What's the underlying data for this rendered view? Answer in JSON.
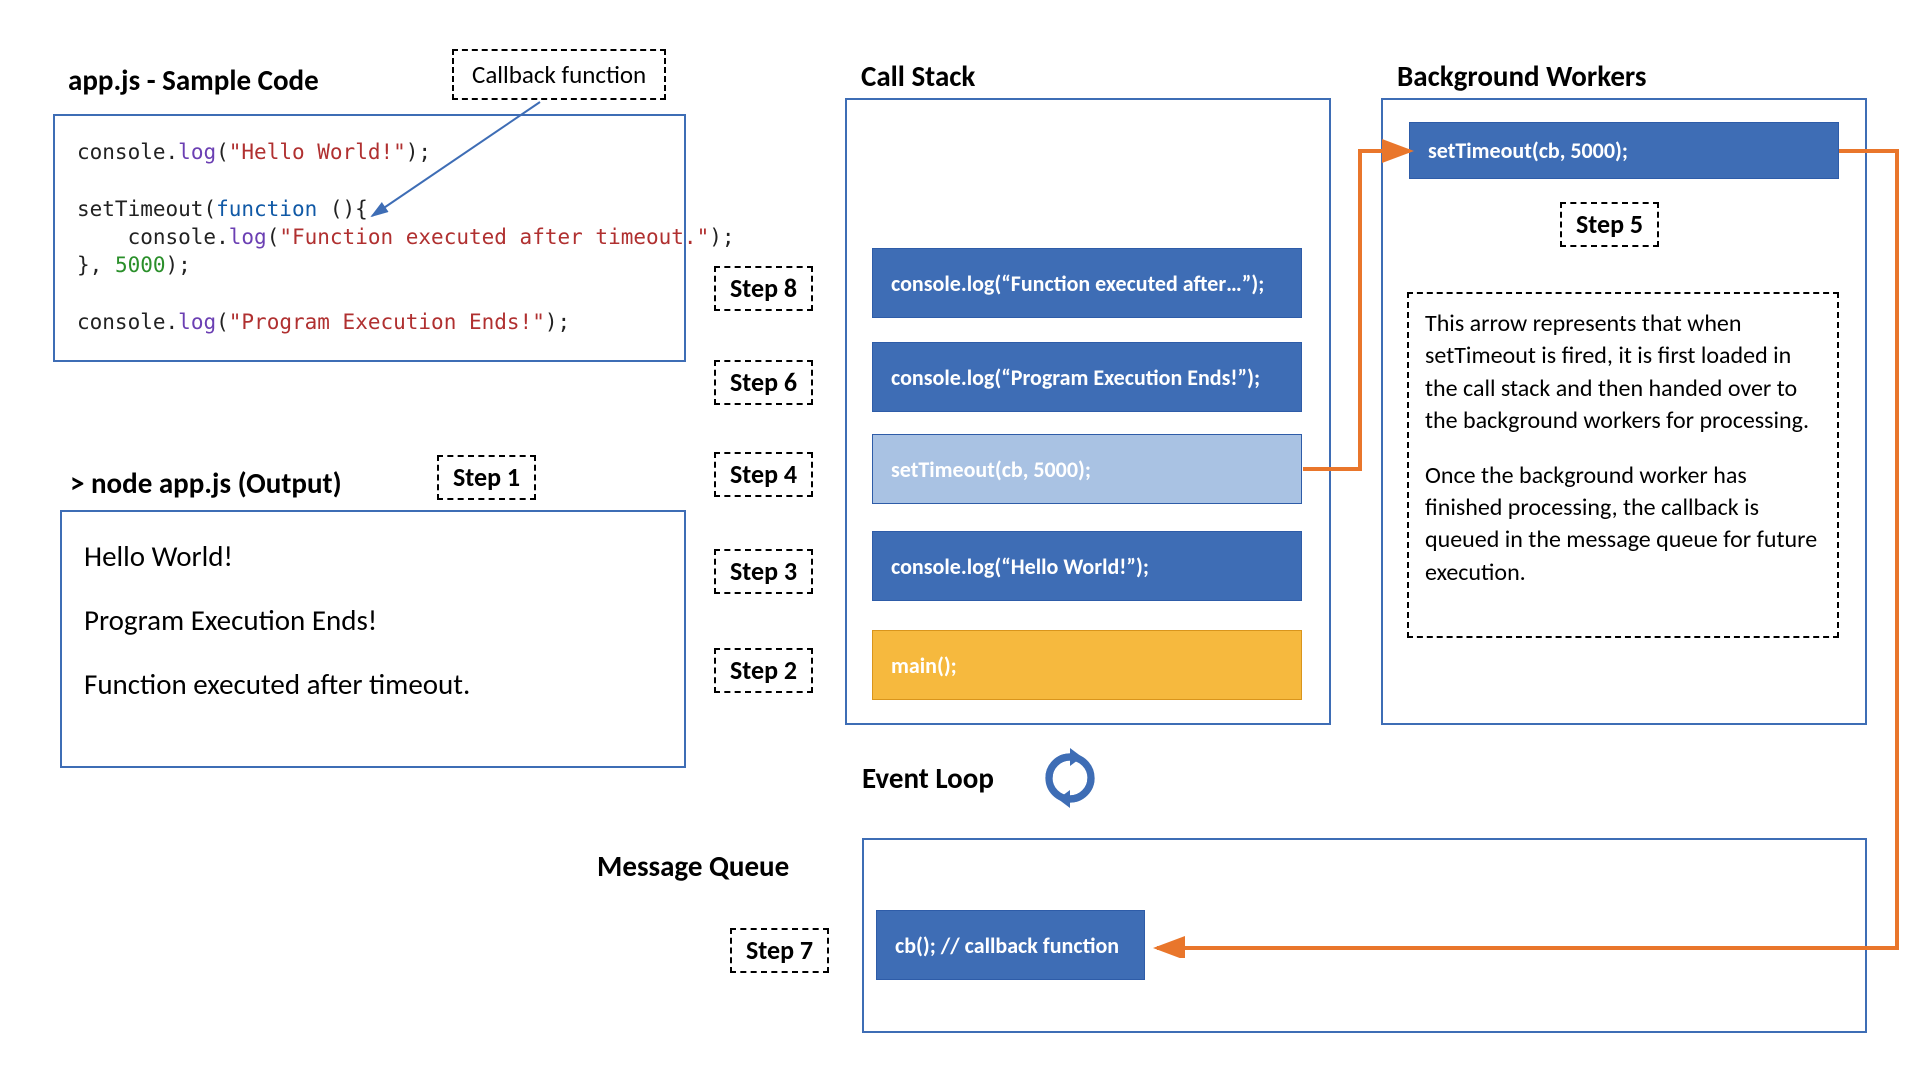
{
  "titles": {
    "code": "app.js - Sample Code",
    "callback": "Callback function",
    "output": "> node app.js (Output)",
    "callstack": "Call Stack",
    "bgworkers": "Background Workers",
    "eventloop": "Event Loop",
    "msgqueue": "Message Queue"
  },
  "code": {
    "l1": {
      "obj": "console",
      "method": "log",
      "str": "\"Hello World!\""
    },
    "l2": {
      "fn": "setTimeout",
      "kw": "function"
    },
    "l3": {
      "obj": "console",
      "method": "log",
      "str": "\"Function executed after timeout.\""
    },
    "l4": {
      "num": "5000"
    },
    "l5": {
      "obj": "console",
      "method": "log",
      "str": "\"Program Execution Ends!\""
    }
  },
  "output_lines": {
    "o1": "Hello World!",
    "o2": "Program Execution Ends!",
    "o3": "Function executed after timeout."
  },
  "steps": {
    "s1": "Step 1",
    "s2": "Step 2",
    "s3": "Step 3",
    "s4": "Step 4",
    "s5": "Step 5",
    "s6": "Step 6",
    "s7": "Step 7",
    "s8": "Step 8"
  },
  "callstack_frames": {
    "f_step8": "console.log(“Function executed after…”);",
    "f_step6": "console.log(“Program Execution Ends!”);",
    "f_step4": "setTimeout(cb, 5000);",
    "f_step3": "console.log(“Hello World!”);",
    "f_main": "main();"
  },
  "bgworker_item": "setTimeout(cb, 5000);",
  "mq_item": "cb(); // callback function",
  "explain_p1": "This arrow represents that when setTimeout is fired, it is first loaded in the call stack and then handed over to the background workers for processing.",
  "explain_p2": "Once the background worker has finished processing, the callback is queued in the message queue for future execution."
}
